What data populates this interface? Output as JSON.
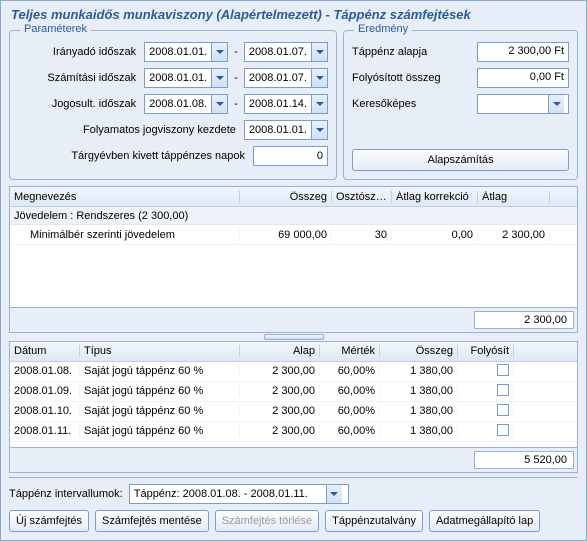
{
  "title": "Teljes munkaidős munkaviszony (Alapértelmezett) - Táppénz számfejtések",
  "groups": {
    "params": "Paraméterek",
    "result": "Eredmény"
  },
  "params": {
    "iranyado_label": "Irányadó időszak",
    "szamitasi_label": "Számítási időszak",
    "jogosult_label": "Jogosult. időszak",
    "folyamatos_label": "Folyamatos jogviszony kezdete",
    "targyev_label": "Tárgyévben kivett táppénzes napok",
    "iranyado_from": "2008.01.01.",
    "iranyado_to": "2008.01.07.",
    "szamitasi_from": "2008.01.01.",
    "szamitasi_to": "2008.01.07.",
    "jogosult_from": "2008.01.08.",
    "jogosult_to": "2008.01.14.",
    "folyamatos_date": "2008.01.01.",
    "targyev_days": "0"
  },
  "result": {
    "alap_label": "Táppénz alapja",
    "alap_value": "2 300,00 Ft",
    "folyositott_label": "Folyósított összeg",
    "folyositott_value": "0,00 Ft",
    "keresokepes_label": "Keresőképes",
    "keresokepes_value": "",
    "calc_button": "Alapszámítás"
  },
  "grid1": {
    "headers": {
      "megnevezes": "Megnevezés",
      "osszeg": "Összeg",
      "osztoszam": "Osztószám",
      "atlagkorr": "Átlag korrekció",
      "atlag": "Átlag"
    },
    "group_row": "Jövedelem : Rendszeres (2 300,00)",
    "rows": [
      {
        "meg": "Minimálbér szerinti jövedelem",
        "osszeg": "69 000,00",
        "osztoszam": "30",
        "atlagkorr": "0,00",
        "atlag": "2 300,00"
      }
    ],
    "sum": "2 300,00"
  },
  "grid2": {
    "headers": {
      "datum": "Dátum",
      "tipus": "Típus",
      "alap": "Alap",
      "mertek": "Mérték",
      "osszeg": "Összeg",
      "folyosit": "Folyósít"
    },
    "rows": [
      {
        "datum": "2008.01.08.",
        "tipus": "Saját jogú táppénz 60 %",
        "alap": "2 300,00",
        "mertek": "60,00%",
        "osszeg": "1 380,00",
        "foly": false
      },
      {
        "datum": "2008.01.09.",
        "tipus": "Saját jogú táppénz 60 %",
        "alap": "2 300,00",
        "mertek": "60,00%",
        "osszeg": "1 380,00",
        "foly": false
      },
      {
        "datum": "2008.01.10.",
        "tipus": "Saját jogú táppénz 60 %",
        "alap": "2 300,00",
        "mertek": "60,00%",
        "osszeg": "1 380,00",
        "foly": false
      },
      {
        "datum": "2008.01.11.",
        "tipus": "Saját jogú táppénz 60 %",
        "alap": "2 300,00",
        "mertek": "60,00%",
        "osszeg": "1 380,00",
        "foly": false
      }
    ],
    "sum": "5 520,00"
  },
  "interval": {
    "label": "Táppénz intervallumok:",
    "value": "Táppénz: 2008.01.08. - 2008.01.11."
  },
  "buttons": {
    "uj": "Új számfejtés",
    "mentes": "Számfejtés mentése",
    "torles": "Számfejtés törlése",
    "utalvany": "Táppénzutalvány",
    "adatlap": "Adatmegállapító lap"
  }
}
